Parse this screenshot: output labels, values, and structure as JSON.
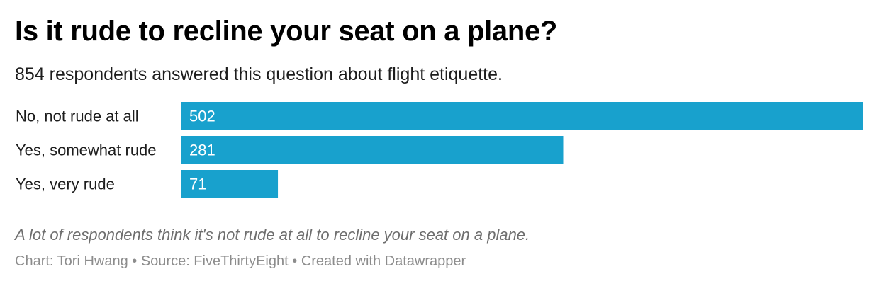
{
  "title": "Is it rude to recline your seat on a plane?",
  "subtitle": "854 respondents answered this question about flight etiquette.",
  "note": "A lot of respondents think it's not rude at all to recline your seat on a plane.",
  "footer": {
    "chart_by": "Chart: Tori Hwang",
    "separator": " • ",
    "source": "Source: FiveThirtyEight",
    "created_with": "Created with Datawrapper"
  },
  "colors": {
    "bar": "#18a1cd",
    "value_text": "#ffffff"
  },
  "chart_data": {
    "type": "bar",
    "orientation": "horizontal",
    "categories": [
      "No, not rude at all",
      "Yes, somewhat rude",
      "Yes, very rude"
    ],
    "values": [
      502,
      281,
      71
    ],
    "title": "Is it rude to recline your seat on a plane?",
    "xlabel": "",
    "ylabel": "",
    "xlim": [
      0,
      502
    ],
    "grid": false,
    "legend": "none",
    "data_labels": "inside-left"
  }
}
